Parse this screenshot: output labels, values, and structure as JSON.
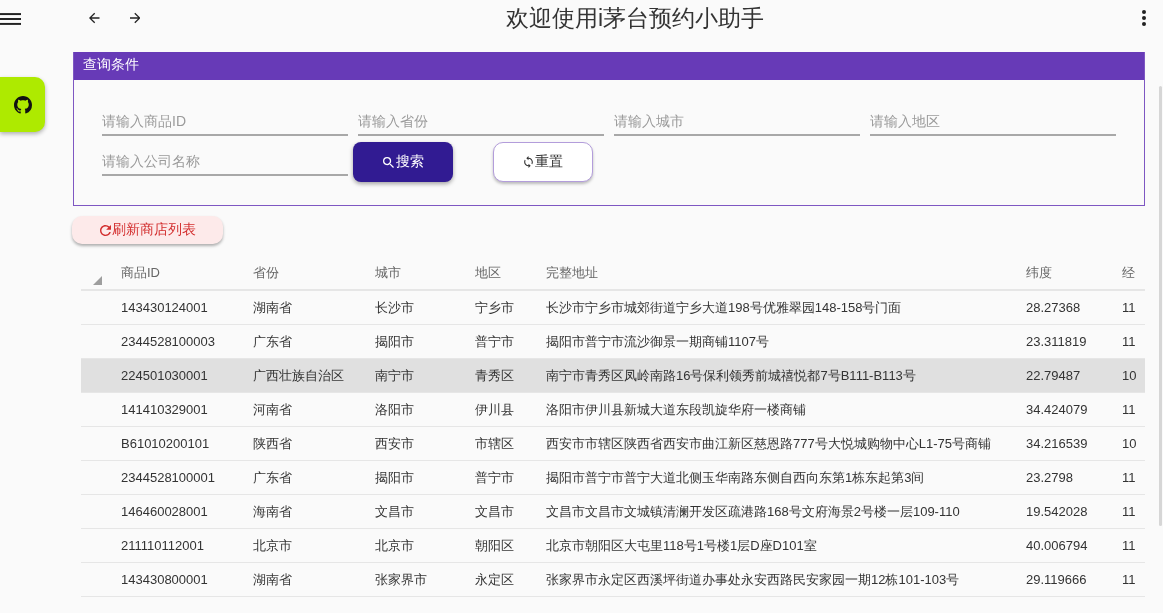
{
  "app_bar": {
    "title": "欢迎使用i茅台预约小助手"
  },
  "query_panel": {
    "title": "查询条件",
    "fields": [
      {
        "placeholder": "请输入商品ID"
      },
      {
        "placeholder": "请输入省份"
      },
      {
        "placeholder": "请输入城市"
      },
      {
        "placeholder": "请输入地区"
      },
      {
        "placeholder": "请输入公司名称"
      }
    ],
    "buttons": [
      {
        "kind": "primary",
        "label": "搜索"
      },
      {
        "kind": "outlined",
        "label": "重置"
      }
    ]
  },
  "refresh_button": {
    "label": "刷新商店列表"
  },
  "table": {
    "columns": [
      "商品ID",
      "省份",
      "城市",
      "地区",
      "完整地址",
      "纬度",
      "经"
    ],
    "rows": [
      {
        "selected": false,
        "cells": [
          "143430124001",
          "湖南省",
          "长沙市",
          "宁乡市",
          "长沙市宁乡市城郊街道宁乡大道198号优雅翠园148-158号门面",
          "28.27368",
          "11"
        ]
      },
      {
        "selected": false,
        "cells": [
          "2344528100003",
          "广东省",
          "揭阳市",
          "普宁市",
          "揭阳市普宁市流沙御景一期商铺1107号",
          "23.311819",
          "11"
        ]
      },
      {
        "selected": true,
        "cells": [
          "224501030001",
          "广西壮族自治区",
          "南宁市",
          "青秀区",
          "南宁市青秀区凤岭南路16号保利领秀前城禧悦都7号B111-B113号",
          "22.79487",
          "10"
        ]
      },
      {
        "selected": false,
        "cells": [
          "141410329001",
          "河南省",
          "洛阳市",
          "伊川县",
          "洛阳市伊川县新城大道东段凯旋华府一楼商铺",
          "34.424079",
          "11"
        ]
      },
      {
        "selected": false,
        "cells": [
          "B61010200101",
          "陕西省",
          "西安市",
          "市辖区",
          "西安市市辖区陕西省西安市曲江新区慈恩路777号大悦城购物中心L1-75号商铺",
          "34.216539",
          "10"
        ]
      },
      {
        "selected": false,
        "cells": [
          "2344528100001",
          "广东省",
          "揭阳市",
          "普宁市",
          "揭阳市普宁市普宁大道北侧玉华南路东侧自西向东第1栋东起第3间",
          "23.2798",
          "11"
        ]
      },
      {
        "selected": false,
        "cells": [
          "146460028001",
          "海南省",
          "文昌市",
          "文昌市",
          "文昌市文昌市文城镇清澜开发区疏港路168号文府海景2号楼一层109-110",
          "19.542028",
          "11"
        ]
      },
      {
        "selected": false,
        "cells": [
          "211110112001",
          "北京市",
          "北京市",
          "朝阳区",
          "北京市朝阳区大屯里118号1号楼1层D座D101室",
          "40.006794",
          "11"
        ]
      },
      {
        "selected": false,
        "cells": [
          "143430800001",
          "湖南省",
          "张家界市",
          "永定区",
          "张家界市永定区西溪坪街道办事处永安西路民安家园一期12栋101-103号",
          "29.119666",
          "11"
        ]
      }
    ]
  }
}
